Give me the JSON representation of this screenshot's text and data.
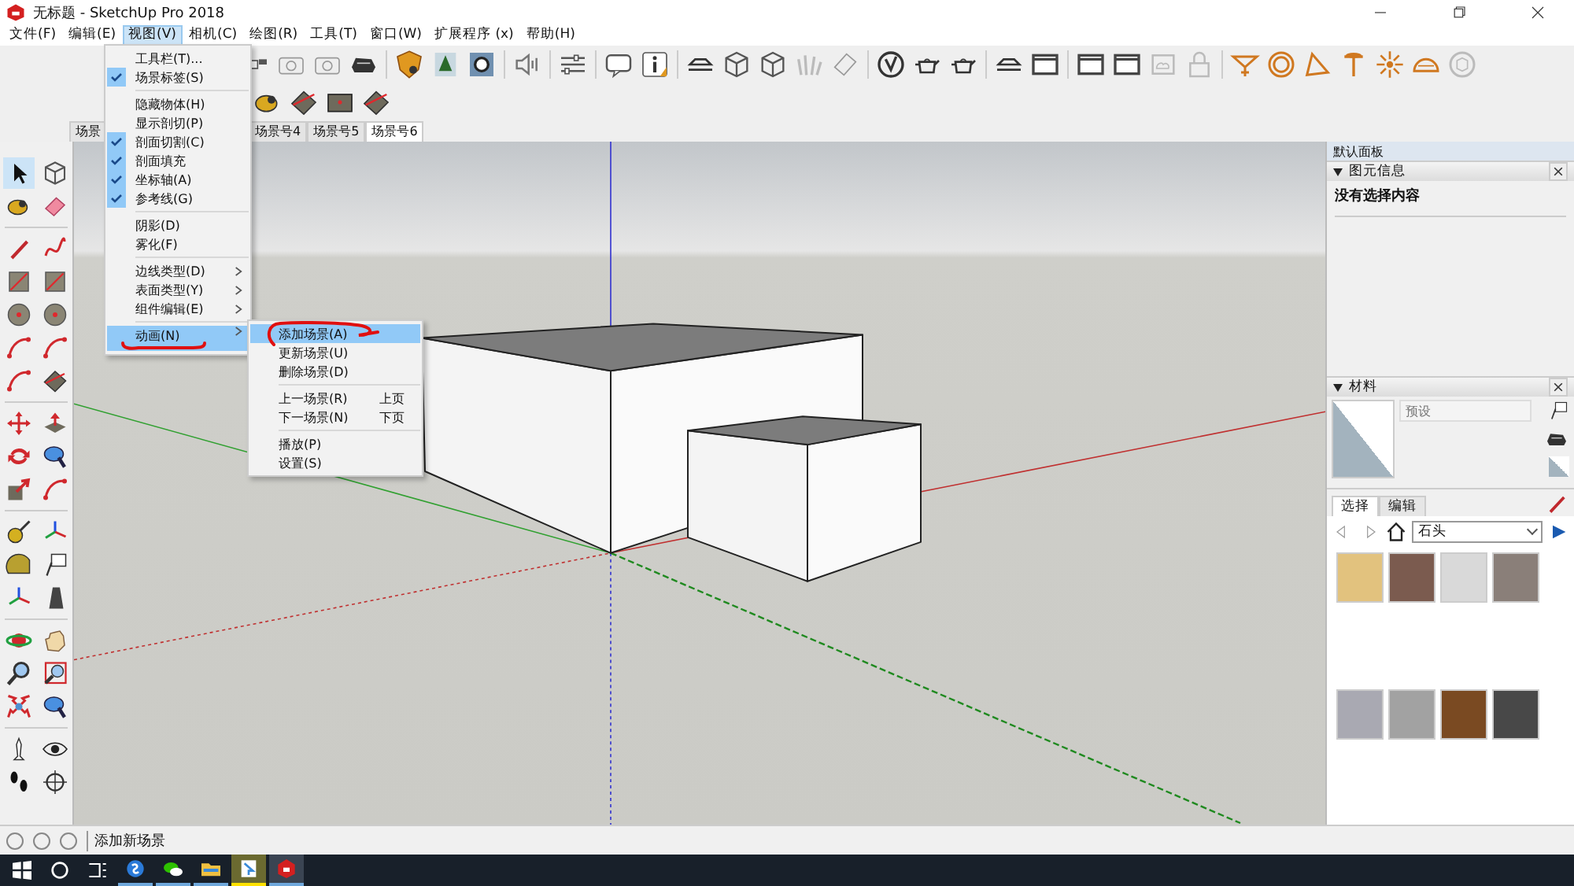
{
  "window": {
    "title": "无标题 - SketchUp Pro 2018"
  },
  "menu_bar": [
    {
      "label": "文件(F)",
      "selected": false
    },
    {
      "label": "编辑(E)",
      "selected": false
    },
    {
      "label": "视图(V)",
      "selected": true
    },
    {
      "label": "相机(C)",
      "selected": false
    },
    {
      "label": "绘图(R)",
      "selected": false
    },
    {
      "label": "工具(T)",
      "selected": false
    },
    {
      "label": "窗口(W)",
      "selected": false
    },
    {
      "label": "扩展程序 (x)",
      "selected": false
    },
    {
      "label": "帮助(H)",
      "selected": false
    }
  ],
  "scene_tabs": [
    {
      "label": "场景",
      "selected": false
    },
    {
      "label": "场景号4",
      "selected": false
    },
    {
      "label": "场景号5",
      "selected": false
    },
    {
      "label": "场景号6",
      "selected": true
    }
  ],
  "view_menu": {
    "groups": [
      [
        {
          "label": "工具栏(T)...",
          "checked": false,
          "submenu": false,
          "selected": false
        },
        {
          "label": "场景标签(S)",
          "checked": true,
          "submenu": false,
          "selected": false
        }
      ],
      [
        {
          "label": "隐藏物体(H)",
          "checked": false,
          "submenu": false,
          "selected": false
        },
        {
          "label": "显示剖切(P)",
          "checked": false,
          "submenu": false,
          "selected": false
        },
        {
          "label": "剖面切割(C)",
          "checked": true,
          "submenu": false,
          "selected": false
        },
        {
          "label": "剖面填充",
          "checked": true,
          "submenu": false,
          "selected": false
        },
        {
          "label": "坐标轴(A)",
          "checked": true,
          "submenu": false,
          "selected": false
        },
        {
          "label": "参考线(G)",
          "checked": true,
          "submenu": false,
          "selected": false
        }
      ],
      [
        {
          "label": "阴影(D)",
          "checked": false,
          "submenu": false,
          "selected": false
        },
        {
          "label": "雾化(F)",
          "checked": false,
          "submenu": false,
          "selected": false
        }
      ],
      [
        {
          "label": "边线类型(D)",
          "checked": false,
          "submenu": true,
          "selected": false
        },
        {
          "label": "表面类型(Y)",
          "checked": false,
          "submenu": true,
          "selected": false
        },
        {
          "label": "组件编辑(E)",
          "checked": false,
          "submenu": true,
          "selected": false
        }
      ],
      [
        {
          "label": "动画(N)",
          "checked": false,
          "submenu": true,
          "selected": true
        }
      ]
    ]
  },
  "animation_submenu": {
    "groups": [
      [
        {
          "label": "添加场景(A)",
          "selected": true
        },
        {
          "label": "更新场景(U)",
          "selected": false
        },
        {
          "label": "删除场景(D)",
          "selected": false
        }
      ],
      [
        {
          "label": "上一场景(R)",
          "shortcut": "上页",
          "selected": false
        },
        {
          "label": "下一场景(N)",
          "shortcut": "下页",
          "selected": false
        }
      ],
      [
        {
          "label": "播放(P)",
          "selected": false
        },
        {
          "label": "设置(S)",
          "selected": false
        }
      ]
    ]
  },
  "tray": {
    "title": "默认面板",
    "entity_info": {
      "title": "图元信息",
      "text": "没有选择内容"
    },
    "materials": {
      "title": "材料",
      "name_placeholder": "预设",
      "tabs": [
        {
          "label": "选择",
          "selected": true
        },
        {
          "label": "编辑",
          "selected": false
        }
      ],
      "library": "石头",
      "swatches": [
        {
          "color": "#e2c27e"
        },
        {
          "color": "#7b5b4f"
        },
        {
          "color": "#d9d9d9"
        },
        {
          "color": "#8a7f79"
        },
        {
          "color": "#a9a9b2"
        },
        {
          "color": "#a2a2a2"
        },
        {
          "color": "#7a4a22"
        },
        {
          "color": "#484848"
        }
      ]
    }
  },
  "status_bar": {
    "text": "添加新场景"
  }
}
